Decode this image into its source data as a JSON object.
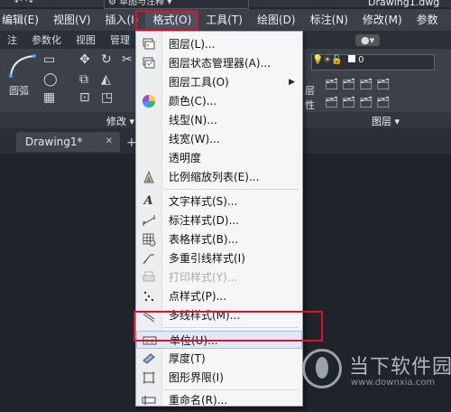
{
  "quick_access": {
    "workspace": "草图与注释",
    "doc_title": "Drawing1.dwg"
  },
  "menubar": {
    "items": [
      {
        "label": "编辑(E)"
      },
      {
        "label": "视图(V)"
      },
      {
        "label": "插入(I)"
      },
      {
        "label": "格式(O)"
      },
      {
        "label": "工具(T)"
      },
      {
        "label": "绘图(D)"
      },
      {
        "label": "标注(N)"
      },
      {
        "label": "修改(M)"
      },
      {
        "label": "参数"
      }
    ]
  },
  "ribbon_tabs": [
    "注",
    "参数化",
    "视图",
    "管理",
    "输"
  ],
  "ribbon": {
    "panel_arc": "圆弧",
    "panel_modify": "修改",
    "panel_layer": "图层",
    "layer_name": "0",
    "layer_props": "层",
    "layer_props2": "性"
  },
  "doc_tab": {
    "label": "Drawing1*",
    "close": "✕",
    "plus": "+"
  },
  "format_menu": {
    "items": [
      {
        "label": "图层(L)...",
        "icon": "layers-icon"
      },
      {
        "label": "图层状态管理器(A)...",
        "icon": "layer-state-icon"
      },
      {
        "label": "图层工具(O)",
        "icon": "",
        "submenu": "▶"
      },
      {
        "label": "颜色(C)...",
        "icon": "color-wheel-icon"
      },
      {
        "label": "线型(N)...",
        "icon": ""
      },
      {
        "label": "线宽(W)...",
        "icon": ""
      },
      {
        "label": "透明度",
        "icon": ""
      },
      {
        "label": "比例缩放列表(E)...",
        "icon": "scale-list-icon"
      },
      {
        "label": "文字样式(S)...",
        "icon": "text-style-icon"
      },
      {
        "label": "标注样式(D)...",
        "icon": "dim-style-icon"
      },
      {
        "label": "表格样式(B)...",
        "icon": "table-style-icon"
      },
      {
        "label": "多重引线样式(I)",
        "icon": "mleader-style-icon"
      },
      {
        "label": "打印样式(Y)...",
        "icon": "plot-style-icon",
        "disabled": true
      },
      {
        "label": "点样式(P)...",
        "icon": "point-style-icon"
      },
      {
        "label": "多线样式(M)...",
        "icon": "mline-style-icon"
      },
      {
        "label": "单位(U)...",
        "icon": "units-icon",
        "highlighted": true
      },
      {
        "label": "厚度(T)",
        "icon": "thickness-icon"
      },
      {
        "label": "图形界限(I)",
        "icon": "limits-icon"
      },
      {
        "label": "重命名(R)...",
        "icon": "rename-icon"
      }
    ]
  },
  "watermark": {
    "text": "当下软件园",
    "url": "www.downxia.com"
  }
}
